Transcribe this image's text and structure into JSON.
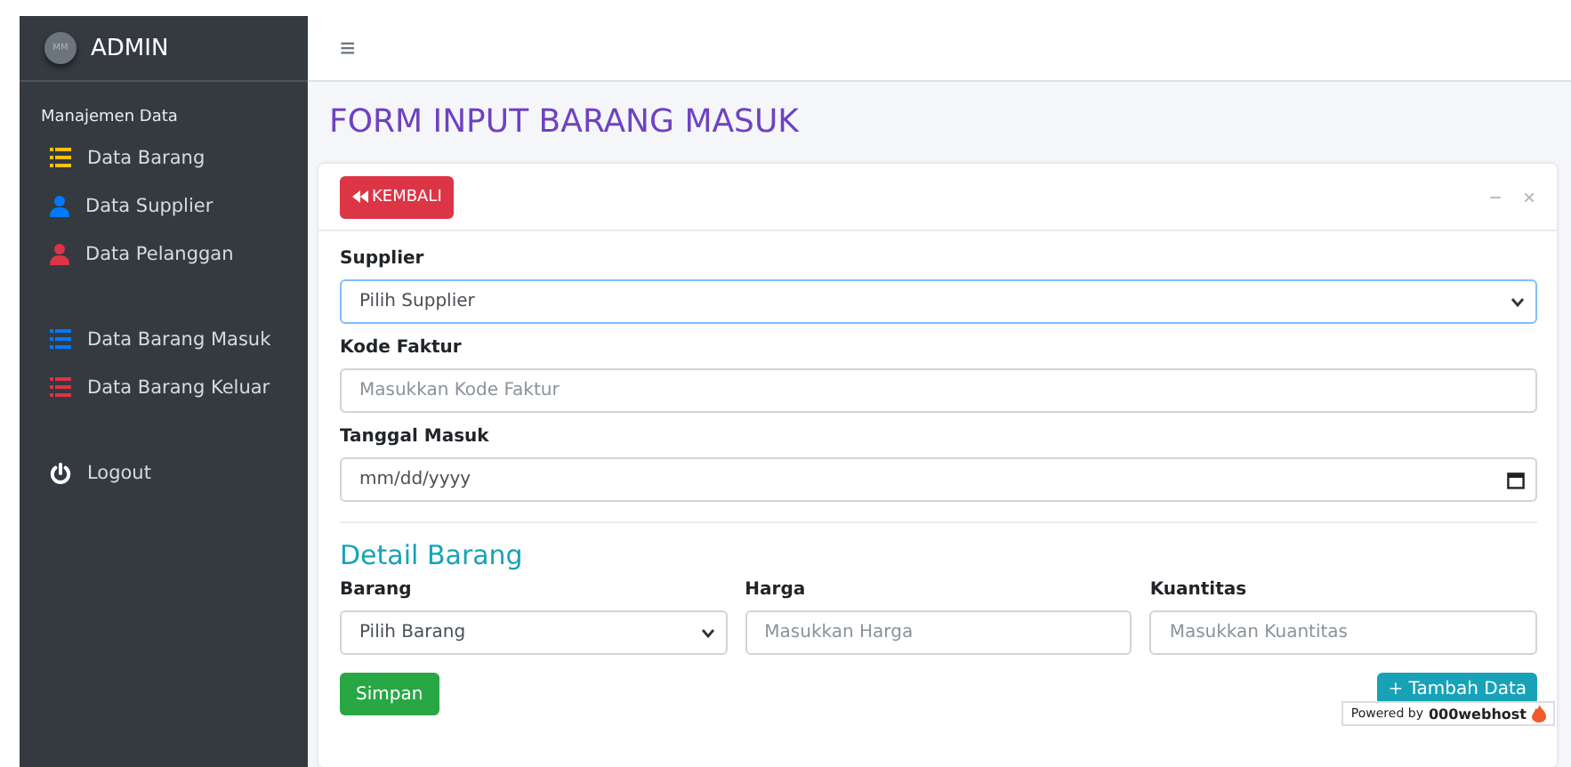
{
  "brand": {
    "avatar": "MM",
    "title": "ADMIN"
  },
  "sidebar": {
    "section": "Manajemen Data",
    "groups": [
      {
        "items": [
          {
            "label": "Data Barang",
            "kind": "list",
            "color": "#ffc107"
          },
          {
            "label": "Data Supplier",
            "kind": "user",
            "color": "#007bff"
          },
          {
            "label": "Data Pelanggan",
            "kind": "user",
            "color": "#dc3545"
          }
        ]
      },
      {
        "items": [
          {
            "label": "Data Barang Masuk",
            "kind": "list",
            "color": "#007bff"
          },
          {
            "label": "Data Barang Keluar",
            "kind": "list",
            "color": "#dc3545"
          }
        ]
      },
      {
        "items": [
          {
            "label": "Logout",
            "kind": "power",
            "color": "#ffffff"
          }
        ]
      }
    ]
  },
  "topbar": {
    "menu": "≡"
  },
  "page_title": "FORM INPUT BARANG MASUK",
  "card": {
    "back_button": "KEMBALI",
    "tools": [
      "−",
      "×"
    ],
    "fields": [
      {
        "label": "Supplier",
        "kind": "select",
        "value": "Pilih Supplier",
        "focused": true
      },
      {
        "label": "Kode Faktur",
        "kind": "text",
        "placeholder": "Masukkan Kode Faktur"
      },
      {
        "label": "Tanggal Masuk",
        "kind": "date",
        "value": "mm/dd/yyyy"
      }
    ],
    "detail_title": "Detail Barang",
    "detail_fields": [
      {
        "label": "Barang",
        "kind": "select",
        "value": "Pilih Barang"
      },
      {
        "label": "Harga",
        "kind": "text",
        "placeholder": "Masukkan Harga"
      },
      {
        "label": "Kuantitas",
        "kind": "text",
        "placeholder": "Masukkan Kuantitas"
      }
    ],
    "save_button": "Simpan",
    "add_button": "+ Tambah Data"
  },
  "badge": {
    "prefix": "Powered by",
    "brand": "000webhost"
  }
}
